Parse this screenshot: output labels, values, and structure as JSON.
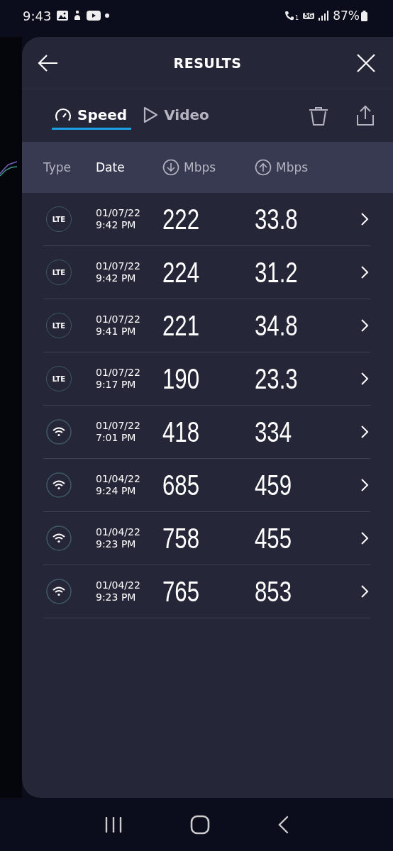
{
  "status_bar": {
    "time": "9:43",
    "sim": "1",
    "network": "5G",
    "battery": "87%"
  },
  "window": {
    "title": "RESULTS"
  },
  "tabs": [
    {
      "label": "Speed",
      "kind": "speed",
      "selected": true
    },
    {
      "label": "Video",
      "kind": "video",
      "selected": false
    }
  ],
  "table": {
    "columns": [
      {
        "label": "Type",
        "kind": "plain"
      },
      {
        "label": "Date",
        "kind": "plain"
      },
      {
        "label": "Mbps",
        "kind": "download"
      },
      {
        "label": "Mbps",
        "kind": "upload"
      }
    ],
    "rows": [
      {
        "type": {
          "kind": "lte",
          "label": "LTE"
        },
        "date": "01/07/22",
        "time": "9:42 PM",
        "download": "222",
        "upload": "33.8"
      },
      {
        "type": {
          "kind": "lte",
          "label": "LTE"
        },
        "date": "01/07/22",
        "time": "9:42 PM",
        "download": "224",
        "upload": "31.2"
      },
      {
        "type": {
          "kind": "lte",
          "label": "LTE"
        },
        "date": "01/07/22",
        "time": "9:41 PM",
        "download": "221",
        "upload": "34.8"
      },
      {
        "type": {
          "kind": "lte",
          "label": "LTE"
        },
        "date": "01/07/22",
        "time": "9:17 PM",
        "download": "190",
        "upload": "23.3"
      },
      {
        "type": {
          "kind": "wifi"
        },
        "date": "01/07/22",
        "time": "7:01 PM",
        "download": "418",
        "upload": "334"
      },
      {
        "type": {
          "kind": "wifi"
        },
        "date": "01/04/22",
        "time": "9:24 PM",
        "download": "685",
        "upload": "459"
      },
      {
        "type": {
          "kind": "wifi"
        },
        "date": "01/04/22",
        "time": "9:23 PM",
        "download": "758",
        "upload": "455"
      },
      {
        "type": {
          "kind": "wifi"
        },
        "date": "01/04/22",
        "time": "9:23 PM",
        "download": "765",
        "upload": "853"
      }
    ]
  }
}
